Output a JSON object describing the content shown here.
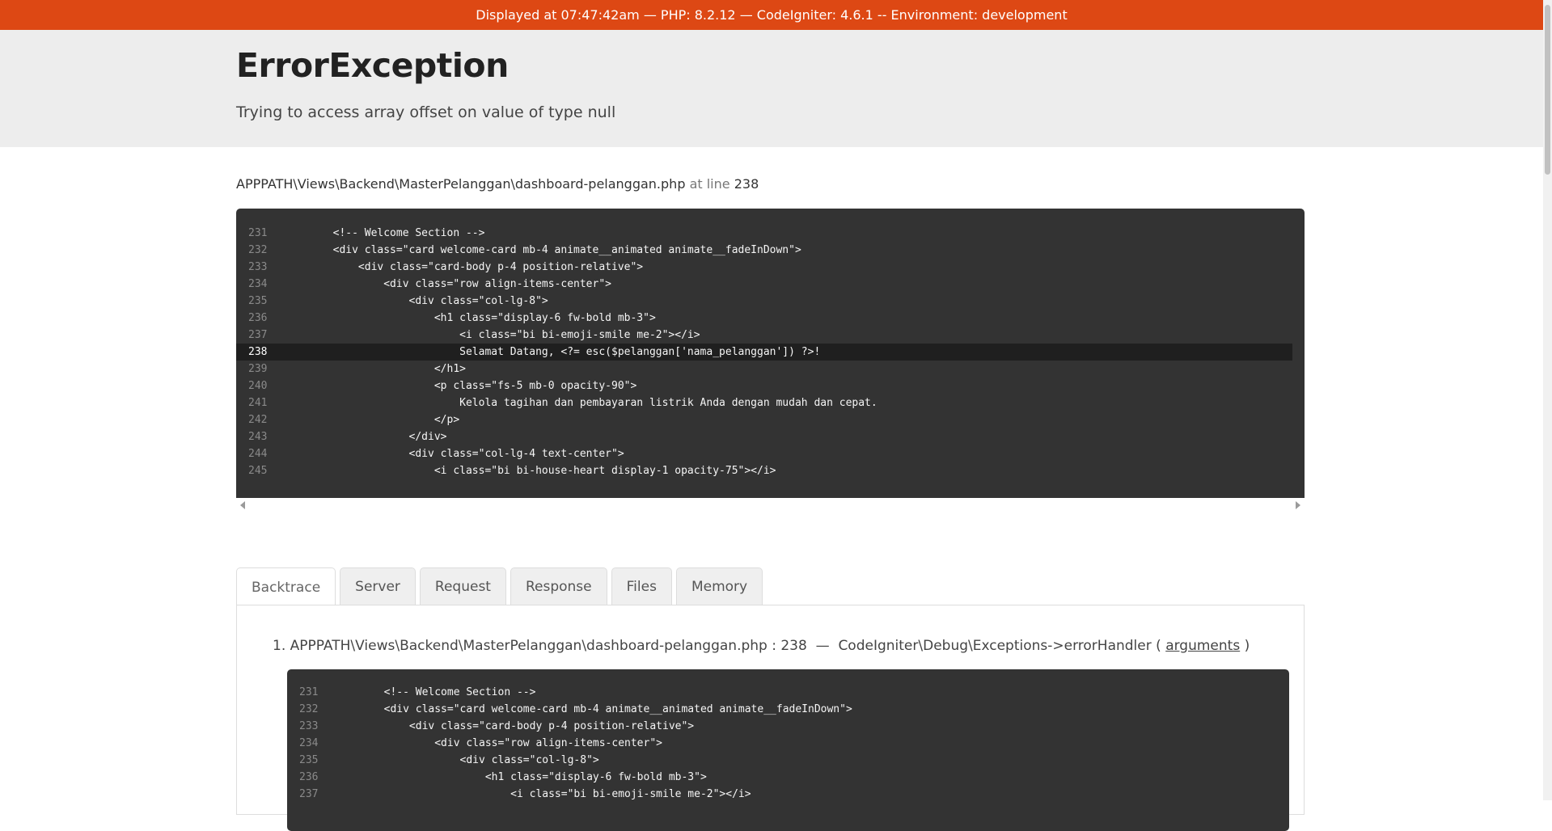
{
  "env_bar": {
    "text": "Displayed at 07:47:42am — PHP: 8.2.12 — CodeIgniter: 4.6.1 -- Environment: development"
  },
  "header": {
    "title": "ErrorException",
    "message": "Trying to access array offset on value of type null"
  },
  "location": {
    "file": "APPPATH\\Views\\Backend\\MasterPelanggan\\dashboard-pelanggan.php",
    "at_line_label": "at line",
    "line": "238"
  },
  "source": {
    "highlight_line": 238,
    "lines": [
      {
        "num": "231",
        "code": "        <!-- Welcome Section -->"
      },
      {
        "num": "232",
        "code": "        <div class=\"card welcome-card mb-4 animate__animated animate__fadeInDown\">"
      },
      {
        "num": "233",
        "code": "            <div class=\"card-body p-4 position-relative\">"
      },
      {
        "num": "234",
        "code": "                <div class=\"row align-items-center\">"
      },
      {
        "num": "235",
        "code": "                    <div class=\"col-lg-8\">"
      },
      {
        "num": "236",
        "code": "                        <h1 class=\"display-6 fw-bold mb-3\">"
      },
      {
        "num": "237",
        "code": "                            <i class=\"bi bi-emoji-smile me-2\"></i>"
      },
      {
        "num": "238",
        "code": "                            Selamat Datang, <?= esc($pelanggan['nama_pelanggan']) ?>!"
      },
      {
        "num": "239",
        "code": "                        </h1>"
      },
      {
        "num": "240",
        "code": "                        <p class=\"fs-5 mb-0 opacity-90\">"
      },
      {
        "num": "241",
        "code": "                            Kelola tagihan dan pembayaran listrik Anda dengan mudah dan cepat."
      },
      {
        "num": "242",
        "code": "                        </p>"
      },
      {
        "num": "243",
        "code": "                    </div>"
      },
      {
        "num": "244",
        "code": "                    <div class=\"col-lg-4 text-center\">"
      },
      {
        "num": "245",
        "code": "                        <i class=\"bi bi-house-heart display-1 opacity-75\"></i>"
      }
    ]
  },
  "tabs": [
    {
      "label": "Backtrace",
      "active": true
    },
    {
      "label": "Server",
      "active": false
    },
    {
      "label": "Request",
      "active": false
    },
    {
      "label": "Response",
      "active": false
    },
    {
      "label": "Files",
      "active": false
    },
    {
      "label": "Memory",
      "active": false
    }
  ],
  "backtrace": {
    "item_number": "1.",
    "file": "APPPATH\\Views\\Backend\\MasterPelanggan\\dashboard-pelanggan.php : 238",
    "separator": "—",
    "function": "CodeIgniter\\Debug\\Exceptions->errorHandler",
    "args_open": "(",
    "args_link": "arguments",
    "args_close": ")",
    "lines": [
      {
        "num": "231",
        "code": "        <!-- Welcome Section -->"
      },
      {
        "num": "232",
        "code": "        <div class=\"card welcome-card mb-4 animate__animated animate__fadeInDown\">"
      },
      {
        "num": "233",
        "code": "            <div class=\"card-body p-4 position-relative\">"
      },
      {
        "num": "234",
        "code": "                <div class=\"row align-items-center\">"
      },
      {
        "num": "235",
        "code": "                    <div class=\"col-lg-8\">"
      },
      {
        "num": "236",
        "code": "                        <h1 class=\"display-6 fw-bold mb-3\">"
      },
      {
        "num": "237",
        "code": "                            <i class=\"bi bi-emoji-smile me-2\"></i>"
      }
    ]
  },
  "colors": {
    "env_bar_bg": "#dd4814",
    "header_bg": "#ededed",
    "code_bg": "#333333",
    "code_highlight_bg": "#1f1f1f"
  }
}
